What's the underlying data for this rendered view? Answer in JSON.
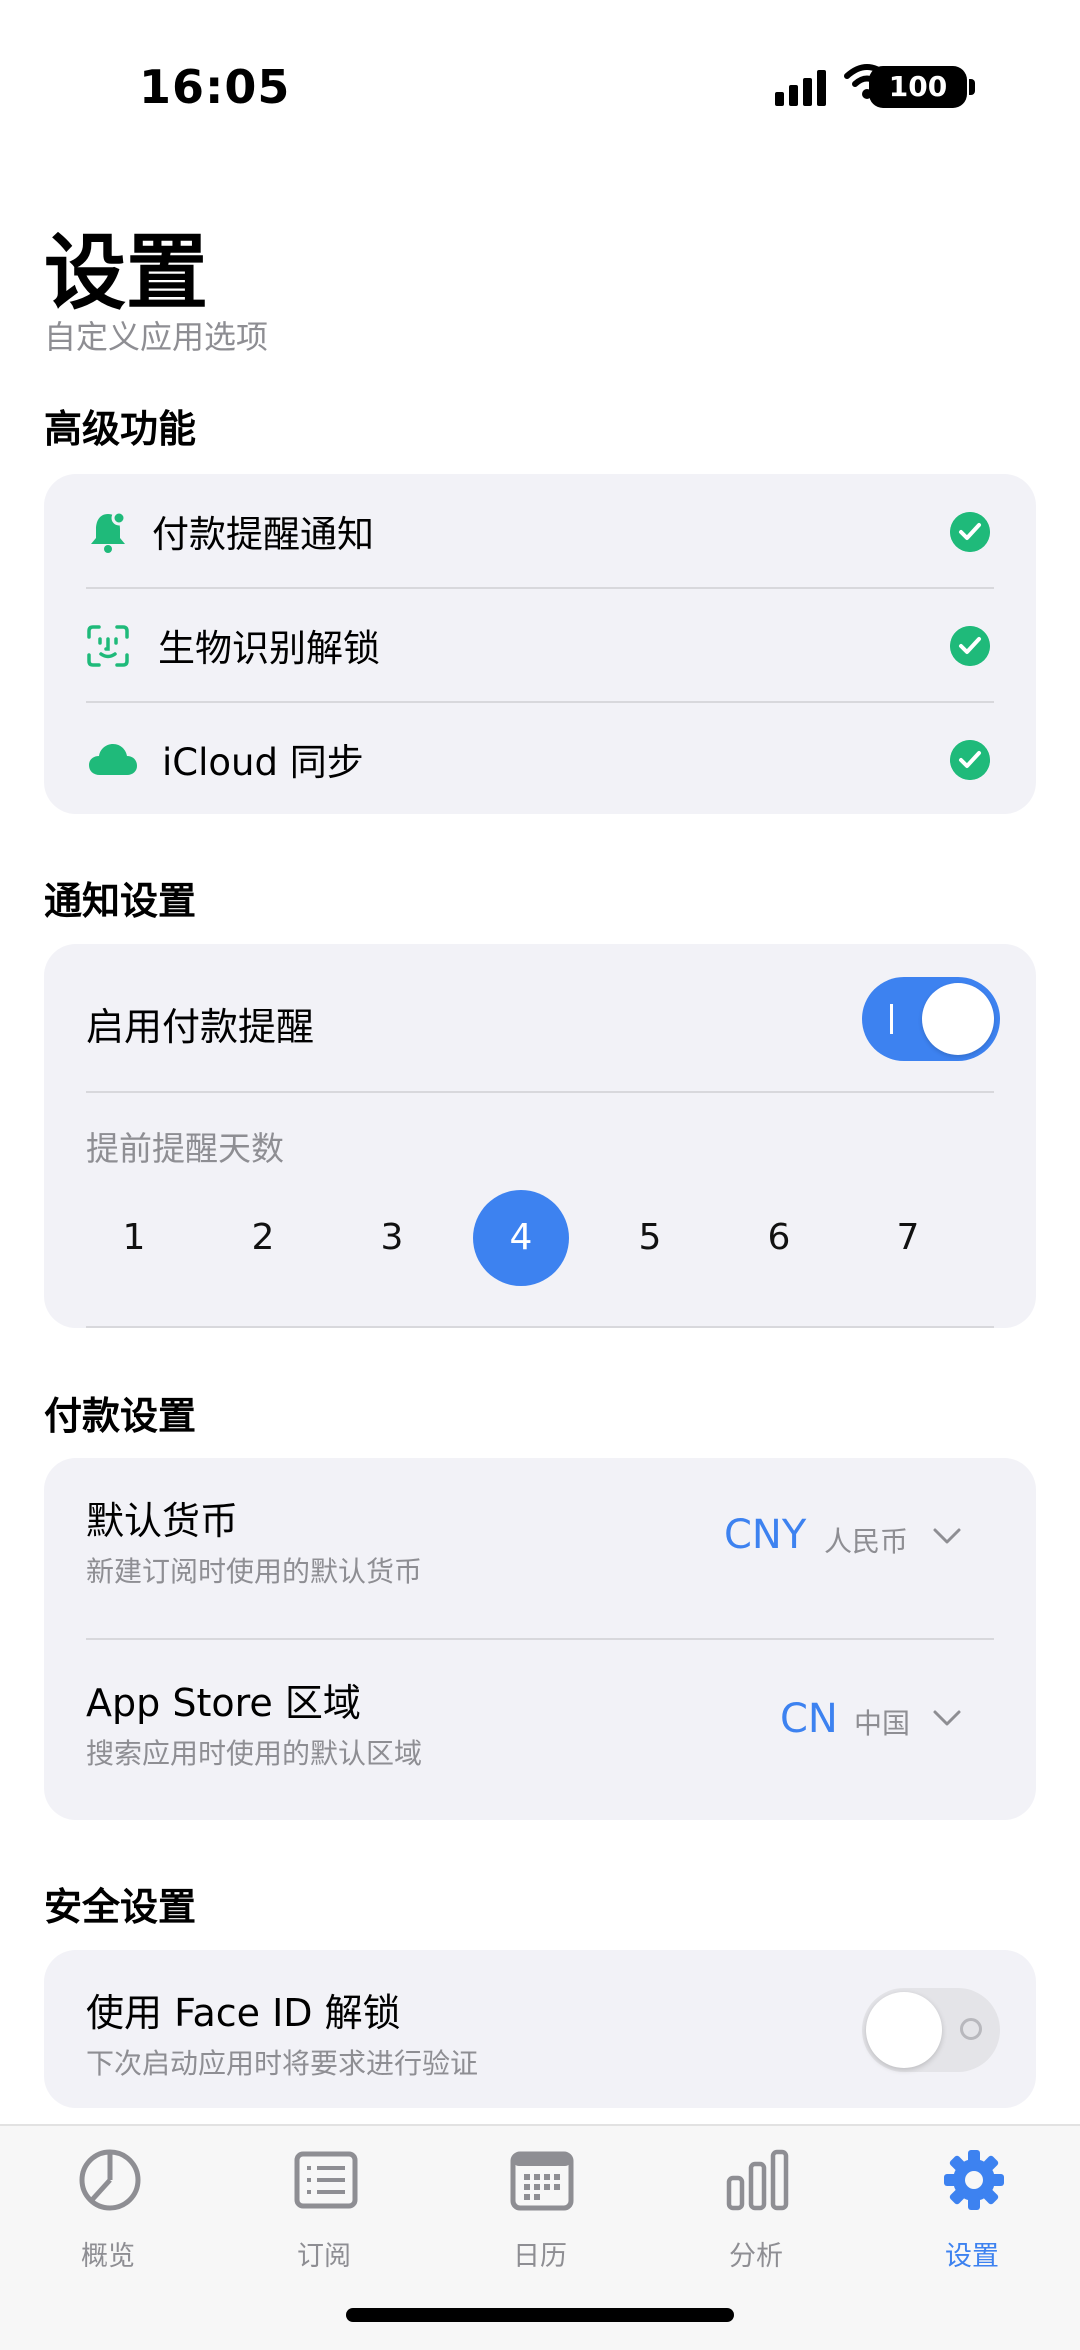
{
  "status_bar": {
    "time": "16:05",
    "battery": "100"
  },
  "header": {
    "title": "设置",
    "subtitle": "自定义应用选项"
  },
  "premium": {
    "heading": "高级功能",
    "items": [
      {
        "label": "付款提醒通知",
        "icon": "bell-icon",
        "checked": true
      },
      {
        "label": "生物识别解锁",
        "icon": "face-id-icon",
        "checked": true
      },
      {
        "label": "iCloud 同步",
        "icon": "cloud-icon",
        "checked": true
      }
    ]
  },
  "notifications": {
    "heading": "通知设置",
    "enable_label": "启用付款提醒",
    "enabled": true,
    "days_label": "提前提醒天数",
    "days": [
      "1",
      "2",
      "3",
      "4",
      "5",
      "6",
      "7"
    ],
    "selected_day": "4"
  },
  "payment": {
    "heading": "付款设置",
    "currency": {
      "title": "默认货币",
      "subtitle": "新建订阅时使用的默认货币",
      "code": "CNY",
      "name": "人民币"
    },
    "region": {
      "title": "App Store 区域",
      "subtitle": "搜索应用时使用的默认区域",
      "code": "CN",
      "name": "中国"
    }
  },
  "security": {
    "heading": "安全设置",
    "faceid": {
      "title": "使用 Face ID 解锁",
      "subtitle": "下次启动应用时将要求进行验证",
      "enabled": false
    }
  },
  "tabs": [
    {
      "label": "概览",
      "icon": "pie-chart-icon"
    },
    {
      "label": "订阅",
      "icon": "list-icon"
    },
    {
      "label": "日历",
      "icon": "calendar-icon"
    },
    {
      "label": "分析",
      "icon": "bar-chart-icon"
    },
    {
      "label": "设置",
      "icon": "gear-icon",
      "active": true
    }
  ],
  "colors": {
    "accent": "#3d82f0",
    "success": "#1fba7a",
    "card": "#f2f2f7",
    "secondary_text": "#8e8e93"
  }
}
